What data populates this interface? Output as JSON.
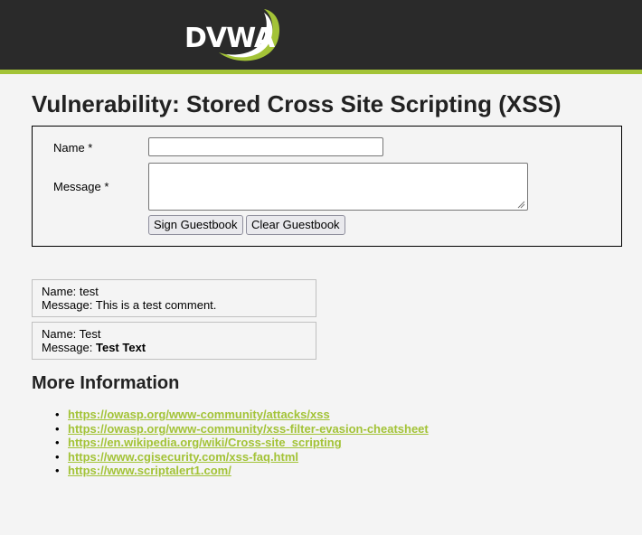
{
  "header": {
    "logo_text": "DVWA",
    "colors": {
      "background": "#2a2a2a",
      "accent": "#a3c337"
    }
  },
  "page_title": "Vulnerability: Stored Cross Site Scripting (XSS)",
  "form": {
    "name_label": "Name *",
    "name_value": "",
    "message_label": "Message *",
    "message_value": "",
    "sign_button": "Sign Guestbook",
    "clear_button": "Clear Guestbook"
  },
  "guestbook": [
    {
      "name_label": "Name: ",
      "name": "test",
      "message_label": "Message: ",
      "message": "This is a test comment."
    },
    {
      "name_label": "Name: ",
      "name": "Test",
      "message_label": "Message: ",
      "message": "Test Text"
    }
  ],
  "more_info": {
    "heading": "More Information",
    "links": [
      "https://owasp.org/www-community/attacks/xss",
      "https://owasp.org/www-community/xss-filter-evasion-cheatsheet",
      "https://en.wikipedia.org/wiki/Cross-site_scripting",
      "https://www.cgisecurity.com/xss-faq.html",
      "https://www.scriptalert1.com/"
    ]
  }
}
